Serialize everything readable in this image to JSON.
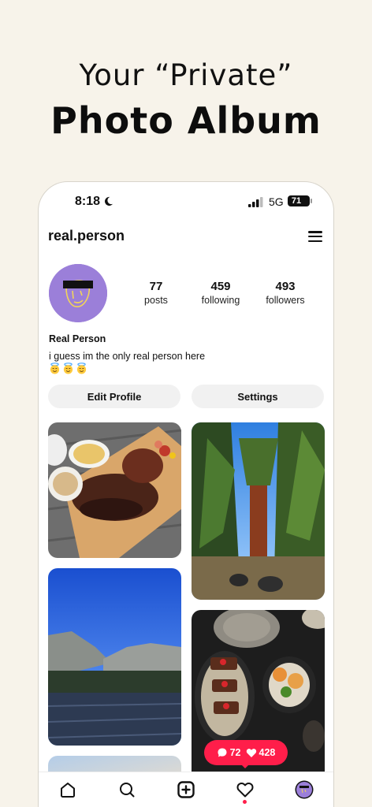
{
  "promo": {
    "headline": "Your “Private”",
    "headline_strong": "Photo Album"
  },
  "status_bar": {
    "time": "8:18",
    "network": "5G",
    "battery": "71"
  },
  "profile": {
    "username": "real.person",
    "display_name": "Real Person",
    "bio": "i guess im the only real person here",
    "stats": [
      {
        "value": "77",
        "label": "posts"
      },
      {
        "value": "459",
        "label": "following"
      },
      {
        "value": "493",
        "label": "followers"
      }
    ],
    "edit_label": "Edit Profile",
    "settings_label": "Settings",
    "avatar_color": "#9b7fd9"
  },
  "notification_pill": {
    "comments": "72",
    "likes": "428",
    "color": "#ff1e4a"
  },
  "tab_bar": {
    "tabs": [
      "home-icon",
      "search-icon",
      "create-icon",
      "activity-icon",
      "profile-avatar"
    ]
  }
}
